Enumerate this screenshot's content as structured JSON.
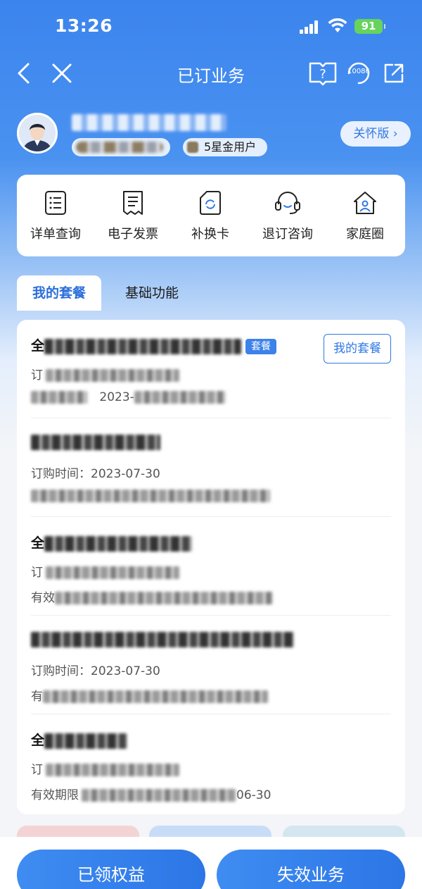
{
  "status_bar": {
    "time": "13:26",
    "battery": "91"
  },
  "nav": {
    "title": "已订业务",
    "service_number": "10086"
  },
  "profile": {
    "star_level": "5星金用户",
    "care_mode_label": "关怀版 ›"
  },
  "quick_actions": [
    {
      "label": "详单查询",
      "icon": "list-document-icon"
    },
    {
      "label": "电子发票",
      "icon": "receipt-icon"
    },
    {
      "label": "补换卡",
      "icon": "sim-card-icon"
    },
    {
      "label": "退订咨询",
      "icon": "headset-icon"
    },
    {
      "label": "家庭圈",
      "icon": "home-user-icon"
    }
  ],
  "tabs": {
    "active": "我的套餐",
    "inactive": "基础功能"
  },
  "packages": [
    {
      "name_prefix": "全",
      "tag": "套餐",
      "button": "我的套餐",
      "order_label": "订",
      "order_date": "",
      "validity_label": "",
      "validity_value": "2023-"
    },
    {
      "name_prefix": "",
      "order_label": "订购时间：",
      "order_date": "2023-07-30",
      "validity_label": "",
      "validity_value": ""
    },
    {
      "name_prefix": "全",
      "order_label": "订",
      "order_date": "",
      "validity_label": "有效",
      "validity_value": ""
    },
    {
      "name_prefix": "",
      "order_label": "订购时间：",
      "order_date": "2023-07-30",
      "validity_label": "有",
      "validity_value": ""
    },
    {
      "name_prefix": "全",
      "order_label": "订",
      "order_date": "",
      "validity_label": "有效期限",
      "validity_value": "06-30"
    }
  ],
  "bottom": {
    "left_button": "已领权益",
    "right_button": "失效业务"
  },
  "colors": {
    "primary": "#2f78e6",
    "header_blue": "#3b84ee",
    "battery_green": "#67d35c"
  }
}
